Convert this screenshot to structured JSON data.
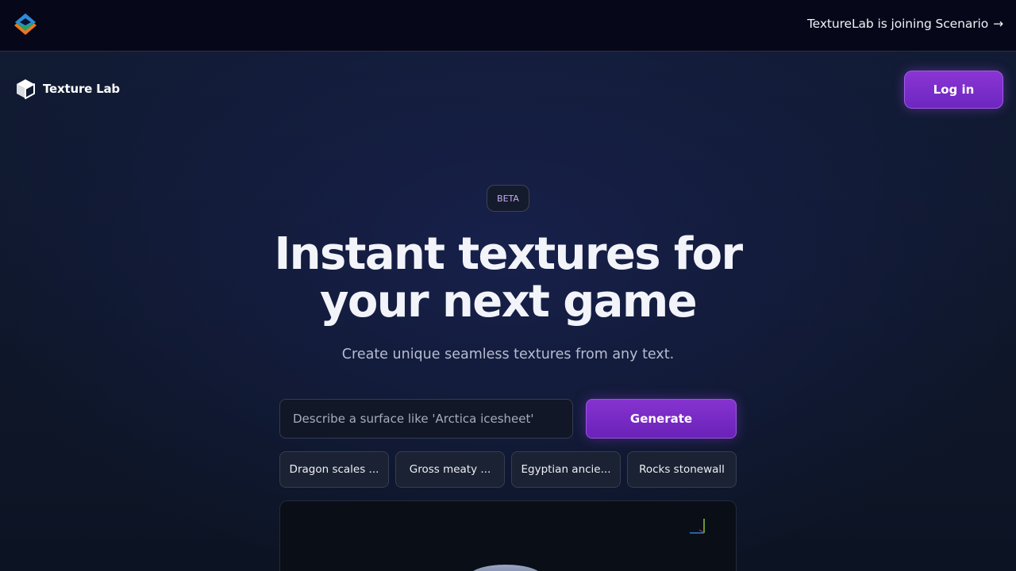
{
  "topbar": {
    "announcement": "TextureLab is joining Scenario",
    "announcement_arrow": "→"
  },
  "header": {
    "brand_name": "Texture Lab",
    "login_label": "Log in"
  },
  "hero": {
    "badge": "BETA",
    "headline_line1": "Instant textures for",
    "headline_line2": "your next game",
    "subheadline": "Create unique seamless textures from any text."
  },
  "prompt": {
    "placeholder": "Describe a surface like 'Arctica icesheet'",
    "value": "",
    "generate_label": "Generate"
  },
  "suggestions": [
    {
      "label": "Dragon scales ..."
    },
    {
      "label": "Gross meaty ..."
    },
    {
      "label": "Egyptian ancie..."
    },
    {
      "label": "Rocks stonewall"
    }
  ],
  "colors": {
    "accent": "#7b2ecb",
    "background": "#0d1526",
    "topbar": "#07071a"
  },
  "icons": {
    "scenario_logo": "layered-diamond-icon",
    "brand_logo": "cube-icon",
    "arrow": "arrow-right-icon",
    "gizmo": "axis-gizmo-icon"
  }
}
